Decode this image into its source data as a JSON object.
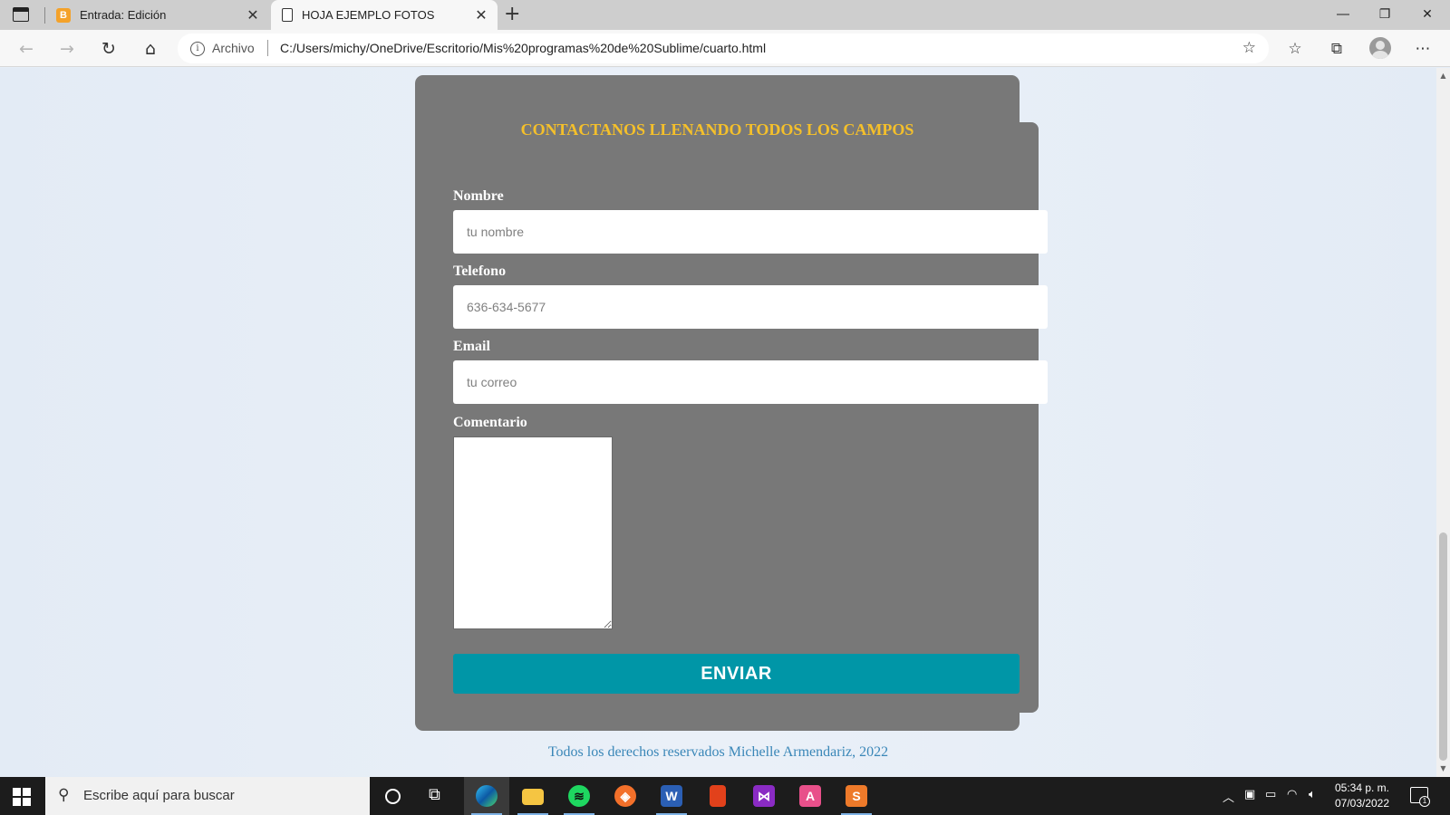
{
  "browser": {
    "tabs": [
      {
        "label": "Entrada: Edición",
        "favicon": "blogger-icon",
        "favicon_letter": "B",
        "active": false
      },
      {
        "label": "HOJA EJEMPLO FOTOS",
        "favicon": "document-icon",
        "active": true
      }
    ],
    "address": {
      "origin_label": "Archivo",
      "url": "C:/Users/michy/OneDrive/Escritorio/Mis%20programas%20de%20Sublime/cuarto.html"
    }
  },
  "page": {
    "form_title": "CONTACTANOS LLENANDO TODOS LOS CAMPOS",
    "fields": {
      "name": {
        "label": "Nombre",
        "placeholder": "tu nombre"
      },
      "phone": {
        "label": "Telefono",
        "placeholder": "636-634-5677"
      },
      "email": {
        "label": "Email",
        "placeholder": "tu correo"
      },
      "comment": {
        "label": "Comentario"
      }
    },
    "submit_label": "ENVIAR",
    "footer": "Todos los derechos reservados Michelle Armendariz, 2022",
    "colors": {
      "card": "#787878",
      "title": "#f5c02a",
      "submit": "#0096a7",
      "footer": "#3a87b8"
    }
  },
  "taskbar": {
    "search_placeholder": "Escribe aquí para buscar",
    "apps": [
      "edge-icon",
      "file-explorer-icon",
      "spotify-icon",
      "brave-icon",
      "word-icon",
      "office-icon",
      "visual-studio-icon",
      "acrobat-icon",
      "sublime-text-icon"
    ],
    "app_letters": {
      "word": "W",
      "acrobat": "A"
    },
    "time": "05:34 p. m.",
    "date": "07/03/2022",
    "notification_count": "1"
  }
}
